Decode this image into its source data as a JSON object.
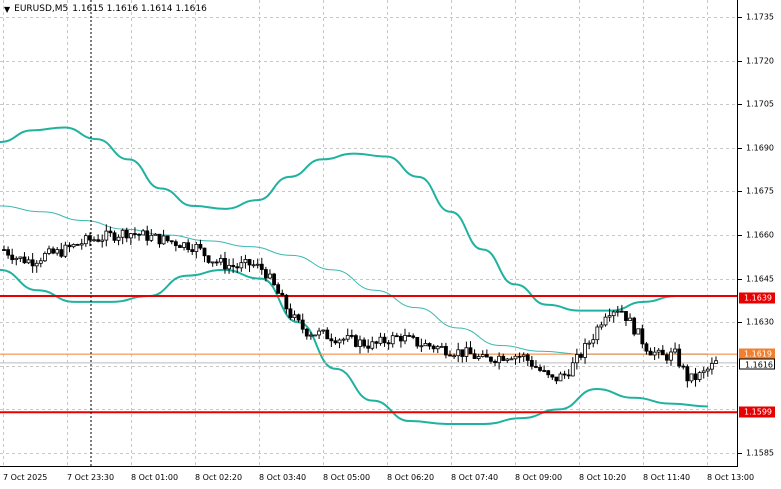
{
  "header": {
    "menu_glyph": "▼",
    "symbol": "EURUSD,M5",
    "ohlc": "1.1615 1.1616 1.1614 1.1616"
  },
  "price_axis": {
    "labels": [
      "1.1735",
      "1.1720",
      "1.1705",
      "1.1690",
      "1.1675",
      "1.1660",
      "1.1645",
      "1.1630",
      "1.1585"
    ]
  },
  "time_axis": {
    "labels": [
      "7 Oct 2025",
      "7 Oct 23:30",
      "8 Oct 01:00",
      "8 Oct 02:20",
      "8 Oct 03:40",
      "8 Oct 05:00",
      "8 Oct 06:20",
      "8 Oct 07:40",
      "8 Oct 09:00",
      "8 Oct 10:20",
      "8 Oct 11:40",
      "8 Oct 13:00"
    ]
  },
  "price_tags": {
    "level_1639": "1.1639",
    "level_1619": "1.1619",
    "current": "1.1616",
    "level_1599": "1.1599"
  },
  "colors": {
    "background": "#ffffff",
    "grid": "#c8c8c8",
    "bollinger": "#20b2a0",
    "moving_average": "#3cb8b0",
    "support_resistance": "#e60000",
    "orange_line": "#f08030",
    "candle_bull": "#ffffff",
    "candle_bear": "#000000"
  },
  "chart_data": {
    "type": "candlestick",
    "symbol": "EURUSD",
    "timeframe": "M5",
    "ylim": [
      1.158,
      1.1745
    ],
    "horizontal_levels": [
      1.1639,
      1.1619,
      1.1599
    ],
    "last_price": 1.1616,
    "close_path": [
      1.1655,
      1.1652,
      1.1651,
      1.1653,
      1.1654,
      1.1656,
      1.1658,
      1.1659,
      1.166,
      1.1661,
      1.166,
      1.1659,
      1.1658,
      1.1657,
      1.1656,
      1.1652,
      1.165,
      1.1649,
      1.165,
      1.1648,
      1.164,
      1.1632,
      1.1627,
      1.1626,
      1.1625,
      1.1624,
      1.1623,
      1.1622,
      1.1624,
      1.1625,
      1.1623,
      1.1622,
      1.1621,
      1.162,
      1.1619,
      1.1617,
      1.1618,
      1.1619,
      1.1618,
      1.1614,
      1.161,
      1.1612,
      1.1618,
      1.1625,
      1.1634,
      1.1635,
      1.1628,
      1.1621,
      1.1618,
      1.1619,
      1.161,
      1.1612,
      1.1616
    ],
    "bollinger_upper": [
      1.1692,
      1.1696,
      1.1697,
      1.1693,
      1.1686,
      1.1676,
      1.167,
      1.1669,
      1.1672,
      1.168,
      1.1686,
      1.1688,
      1.1687,
      1.168,
      1.1668,
      1.1655,
      1.1643,
      1.1636,
      1.1634,
      1.1634,
      1.1637,
      1.1639,
      1.1639
    ],
    "bollinger_middle": [
      1.167,
      1.1668,
      1.1665,
      1.1662,
      1.166,
      1.1658,
      1.1656,
      1.1653,
      1.1648,
      1.1641,
      1.1635,
      1.1628,
      1.1622,
      1.162,
      1.1619,
      1.1619,
      1.1619,
      1.1619
    ],
    "bollinger_lower": [
      1.1648,
      1.1641,
      1.1637,
      1.1637,
      1.1639,
      1.1646,
      1.1648,
      1.1645,
      1.163,
      1.1614,
      1.1603,
      1.1596,
      1.1595,
      1.1595,
      1.1597,
      1.16,
      1.1607,
      1.1604,
      1.1602,
      1.1601
    ]
  }
}
